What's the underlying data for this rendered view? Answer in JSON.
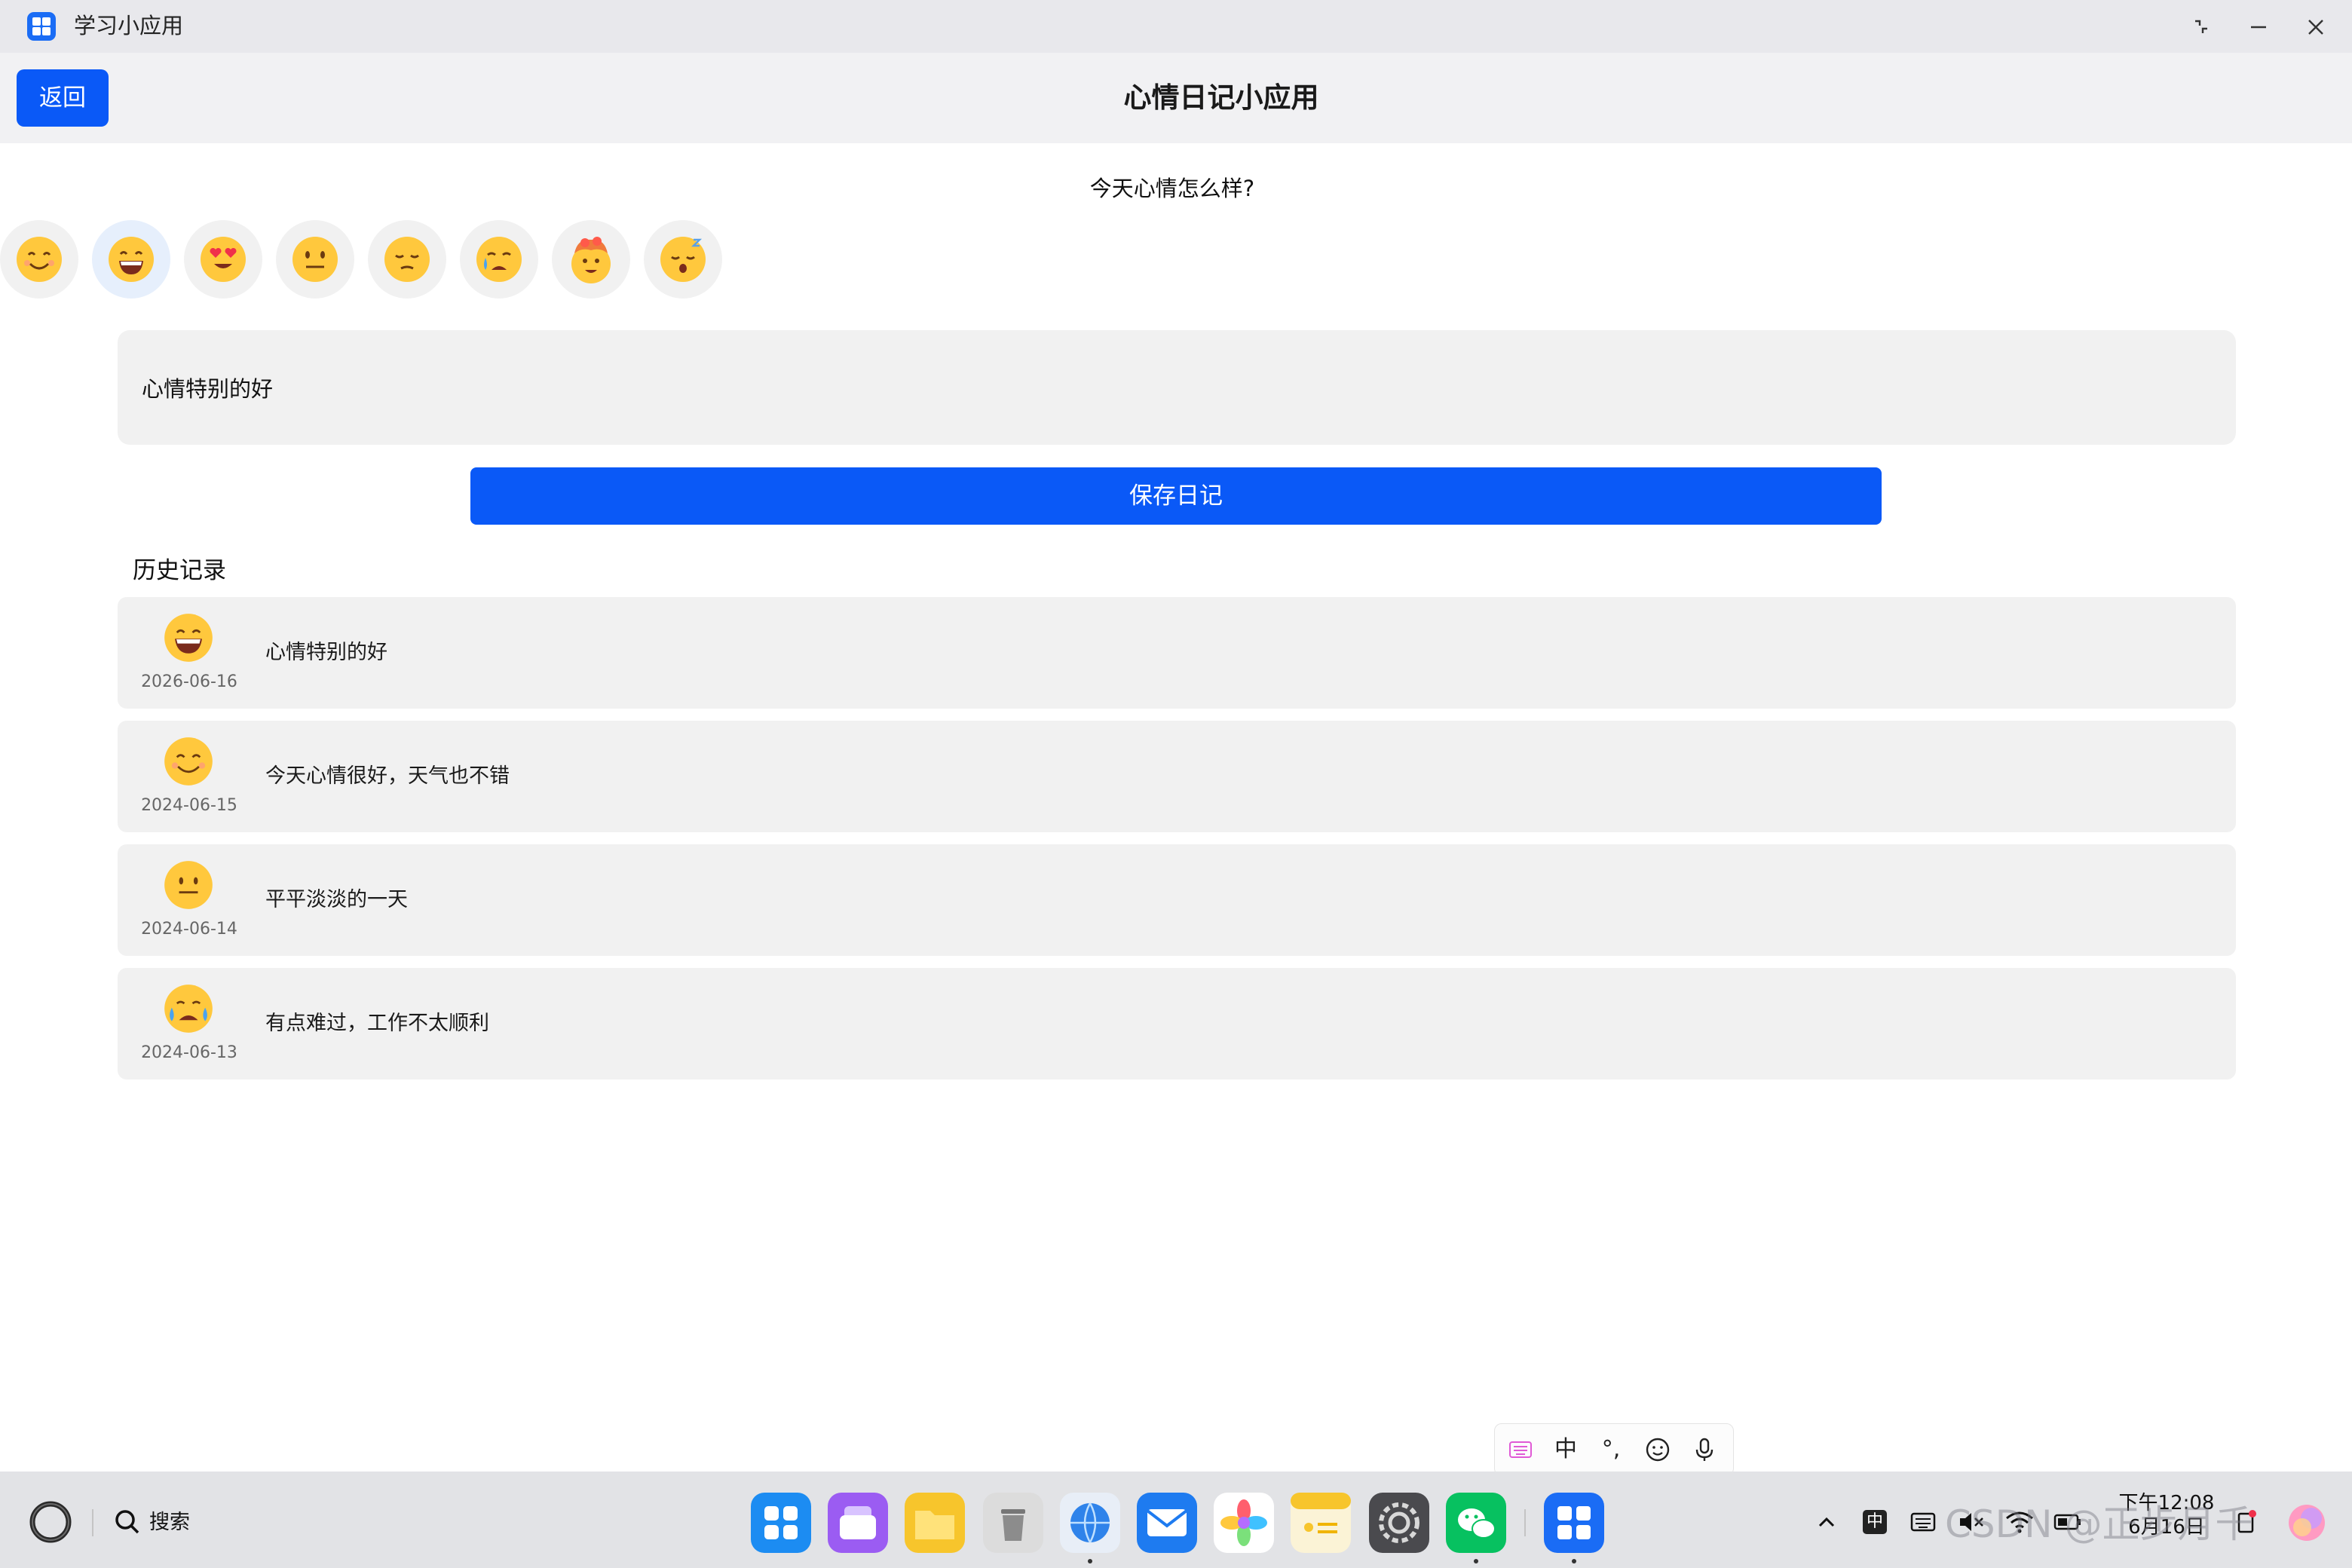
{
  "window": {
    "app_title": "学习小应用"
  },
  "header": {
    "back_label": "返回",
    "title": "心情日记小应用"
  },
  "mood_picker": {
    "question": "今天心情怎么样?",
    "moods": [
      "smiling-face",
      "grinning-face",
      "heart-eyes-face",
      "neutral-face",
      "pensive-face",
      "crying-face",
      "exploding-head-face",
      "sleeping-face"
    ],
    "selected_index": 1
  },
  "diary_input": {
    "value": "心情特别的好"
  },
  "save_label": "保存日记",
  "history": {
    "title": "历史记录",
    "items": [
      {
        "emoji": "grinning-face",
        "date": "2026-06-16",
        "text": "心情特别的好"
      },
      {
        "emoji": "smiling-face",
        "date": "2024-06-15",
        "text": "今天心情很好，天气也不错"
      },
      {
        "emoji": "neutral-face",
        "date": "2024-06-14",
        "text": "平平淡淡的一天"
      },
      {
        "emoji": "crying-face",
        "date": "2024-06-13",
        "text": "有点难过，工作不太顺利"
      }
    ]
  },
  "ime_toolbar": {
    "mode_label": "中",
    "punct_label": "°,"
  },
  "taskbar": {
    "search_label": "搜索",
    "ime_indicator": "中",
    "time": "下午12:08",
    "date": "6月16日",
    "watermark": "CSDN @正步月千"
  },
  "colors": {
    "accent": "#0a59f7",
    "card": "#f1f1f1",
    "header_bg": "#f1f1f3"
  }
}
